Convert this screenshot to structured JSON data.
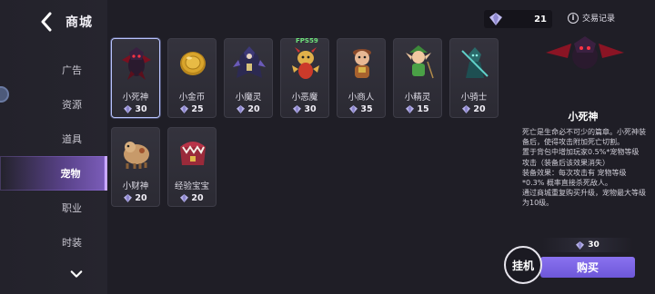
{
  "header": {
    "title": "商城",
    "back_icon": "chevron-left-icon"
  },
  "sidebar": {
    "items": [
      {
        "label": "广告",
        "active": false
      },
      {
        "label": "资源",
        "active": false
      },
      {
        "label": "道具",
        "active": false
      },
      {
        "label": "宠物",
        "active": true
      },
      {
        "label": "职业",
        "active": false
      },
      {
        "label": "时装",
        "active": false
      }
    ],
    "more_icon": "chevron-down-icon"
  },
  "currency": {
    "icon": "gem-icon",
    "amount": "21"
  },
  "trade_record": {
    "label": "交易记录",
    "icon": "info-icon"
  },
  "pets": [
    {
      "name": "小死神",
      "price": "30",
      "selected": true
    },
    {
      "name": "小金币",
      "price": "25"
    },
    {
      "name": "小魔灵",
      "price": "20"
    },
    {
      "name": "小恶魔",
      "price": "30",
      "tag": "FPS59"
    },
    {
      "name": "小商人",
      "price": "35"
    },
    {
      "name": "小精灵",
      "price": "15"
    },
    {
      "name": "小骑士",
      "price": "20"
    },
    {
      "name": "小财神",
      "price": "20"
    },
    {
      "name": "经验宝宝",
      "price": "20"
    }
  ],
  "detail": {
    "title": "小死神",
    "lines": [
      "死亡是生命必不可少的篇章。小死神装备后，使得攻击附加死亡切割。",
      "置于背包中增加玩家0.5%*宠物等级攻击（装备后该效果消失）",
      "装备效果：每次攻击有 宠物等级*0.3% 概率直接杀死敌人。",
      "通过商城重复购买升级，宠物最大等级为10级。"
    ],
    "price": "30",
    "buy_label": "购买",
    "hang_label": "挂机"
  },
  "colors": {
    "accent": "#7a63e4",
    "active_nav": "#9470e0",
    "background": "#1f1e26",
    "card": "#302f38"
  }
}
